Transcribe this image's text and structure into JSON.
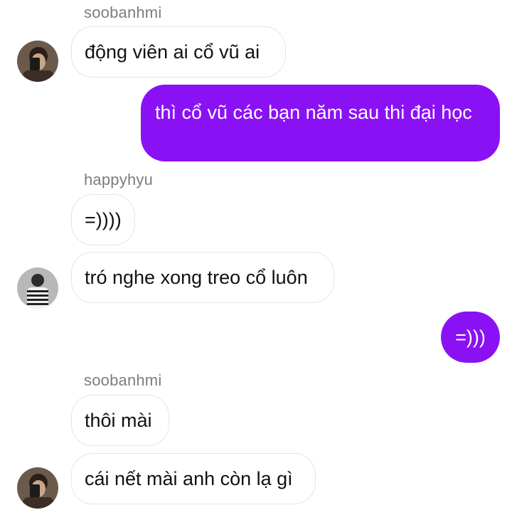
{
  "messages": [
    {
      "sender": "soobanhmi",
      "text": "động viên ai cổ vũ ai",
      "direction": "incoming"
    },
    {
      "text": "thì cổ vũ các bạn năm sau thi đại học",
      "direction": "outgoing"
    },
    {
      "sender": "happyhyu",
      "text": "=))))",
      "direction": "incoming"
    },
    {
      "text": "tró nghe xong treo cổ luôn",
      "direction": "incoming"
    },
    {
      "text": "=)))",
      "direction": "outgoing"
    },
    {
      "sender": "soobanhmi",
      "text": "thôi mài",
      "direction": "incoming"
    },
    {
      "text": "cái nết mài anh còn lạ gì",
      "direction": "incoming"
    }
  ],
  "colors": {
    "outgoing_bubble": "#8b11f5",
    "incoming_bubble_border": "#e6e6e6",
    "sender_name": "#7d7d7d"
  }
}
